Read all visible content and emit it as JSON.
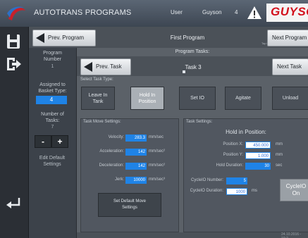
{
  "app": {
    "title": "AUTOTRANS PROGRAMS",
    "user_label": "User",
    "user_name": "Guyson",
    "user_level": "4",
    "brand": "GUYSON",
    "colors": {
      "brand_red": "#d3101c",
      "accent_blue": "#1f83e6"
    }
  },
  "rail": {
    "icons": [
      "save-icon",
      "exit-icon",
      "return-icon"
    ]
  },
  "program_nav": {
    "prev_label": "Prev. Program",
    "next_label": "Next Program",
    "program_name": "First Program",
    "tap_hint": "Tap to Edit"
  },
  "program_info": {
    "program_number_label_1": "Program",
    "program_number_label_2": "Number",
    "program_number_value": "1",
    "basket_label_1": "Assigned to",
    "basket_label_2": "Basket Type:",
    "basket_value": "4",
    "tasks_label_1": "Number of",
    "tasks_label_2": "Tasks:",
    "tasks_value": "7",
    "minus": "-",
    "plus": "+",
    "edit_label_1": "Edit Default",
    "edit_label_2": "Settings"
  },
  "tasks_panel": {
    "title": "Program Tasks:",
    "prev_label": "Prev. Task",
    "next_label": "Next Task",
    "task_name": "Task 3"
  },
  "task_type": {
    "label": "Select Task Type:",
    "leave_1": "Leave In",
    "leave_2": "Tank",
    "hold_1": "Hold In",
    "hold_2": "Position",
    "set_io": "Set IO",
    "agitate": "Agitate",
    "unload": "Unload",
    "selected": "Hold In Position"
  },
  "move_settings": {
    "title": "Task Move Settings:",
    "velocity_label": "Velocity:",
    "velocity_value": "283.3",
    "velocity_unit": "mm/sec",
    "accel_label": "Acceleration:",
    "accel_value": "142",
    "accel_unit": "mm/sec²",
    "decel_label": "Deceleration:",
    "decel_value": "142",
    "decel_unit": "mm/sec²",
    "jerk_label": "Jerk:",
    "jerk_value": "10000",
    "jerk_unit": "mm/sec³",
    "set_default_1": "Set Default Move",
    "set_default_2": "Settings"
  },
  "task_settings": {
    "title": "Task Settings:",
    "hold_title": "Hold in Position:",
    "position_x_label": "Position X:",
    "position_x_value": "450.000",
    "position_x_unit": "mm",
    "position_y_label": "Position Y:",
    "position_y_value": "1.000",
    "position_y_unit": "mm",
    "hold_label": "Hold Duration:",
    "hold_value": "30",
    "hold_unit": "sec",
    "cycleio_num_label": "CycleIO Number:",
    "cycleio_num_value": "5",
    "cycleio_dur_label": "CycleIO Duration:",
    "cycleio_dur_value": "1000",
    "cycleio_dur_unit": "ms",
    "cycle_btn_1": "CycleIO",
    "cycle_btn_2": "On"
  },
  "status": {
    "timestamp": "24.10.2016 - 10:2"
  }
}
